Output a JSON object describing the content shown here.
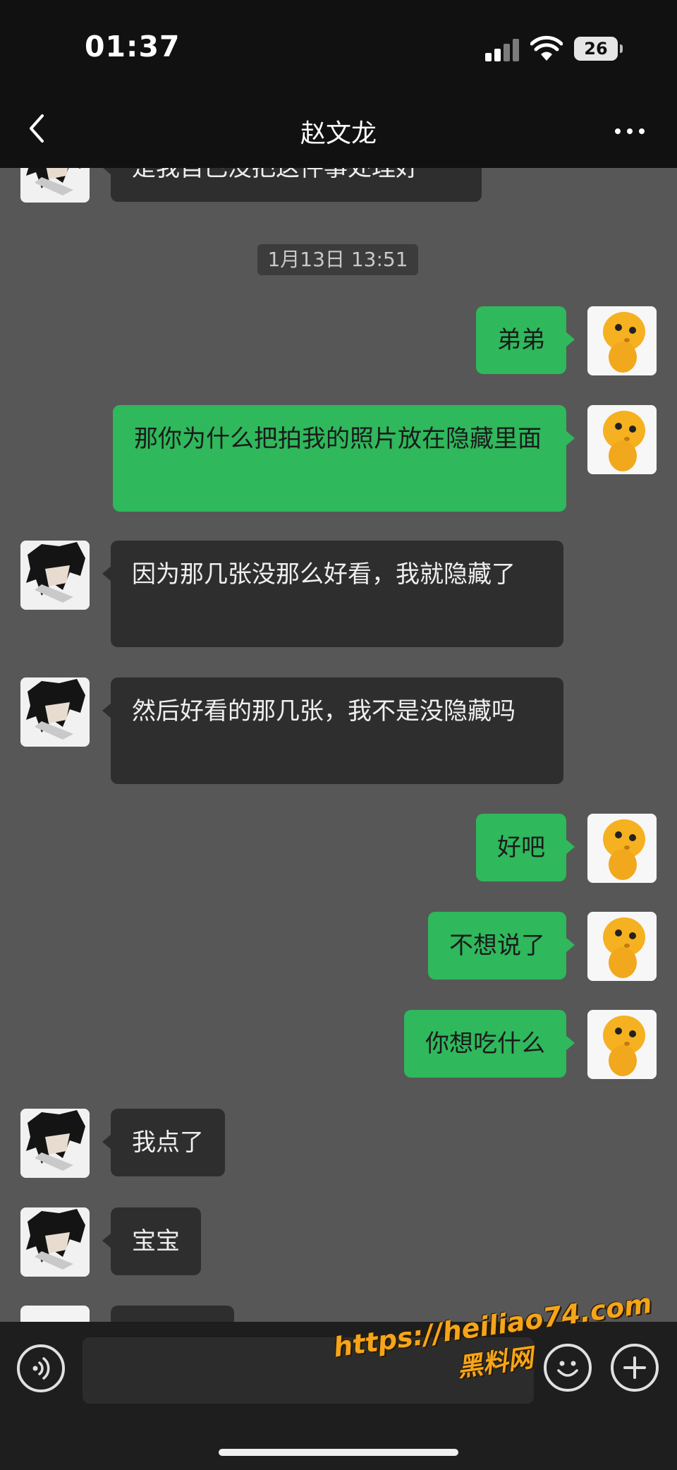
{
  "status_bar": {
    "time": "01:37",
    "battery_level": "26",
    "icons": [
      "cellular-signal-icon",
      "wifi-icon",
      "battery-icon"
    ]
  },
  "nav": {
    "title": "赵文龙",
    "back_icon": "chevron-left-icon",
    "more_icon": "ellipsis-icon"
  },
  "timestamp": "1月13日 13:51",
  "messages": [
    {
      "sender": "friend",
      "text": "是我自己没把这件事处理好",
      "partial": true
    },
    {
      "sender": "me",
      "text": "弟弟"
    },
    {
      "sender": "me",
      "text": "那你为什么把拍我的照片放在隐藏里面"
    },
    {
      "sender": "friend",
      "text": "因为那几张没那么好看，我就隐藏了"
    },
    {
      "sender": "friend",
      "text": "然后好看的那几张，我不是没隐藏吗"
    },
    {
      "sender": "me",
      "text": "好吧"
    },
    {
      "sender": "me",
      "text": "不想说了"
    },
    {
      "sender": "me",
      "text": "你想吃什么"
    },
    {
      "sender": "friend",
      "text": "我点了"
    },
    {
      "sender": "friend",
      "text": "宝宝"
    }
  ],
  "input_bar": {
    "voice_icon": "voice-input-icon",
    "text_value": "",
    "emoji_icon": "emoji-icon",
    "plus_icon": "plus-icon"
  },
  "watermark": {
    "url": "https://heiliao74.com",
    "name": "黑料网"
  },
  "colors": {
    "chat_background": "#575757",
    "my_bubble": "#2fb85c",
    "friend_bubble": "#2e2e2e",
    "header": "#111111",
    "watermark": "#f5a51a"
  }
}
